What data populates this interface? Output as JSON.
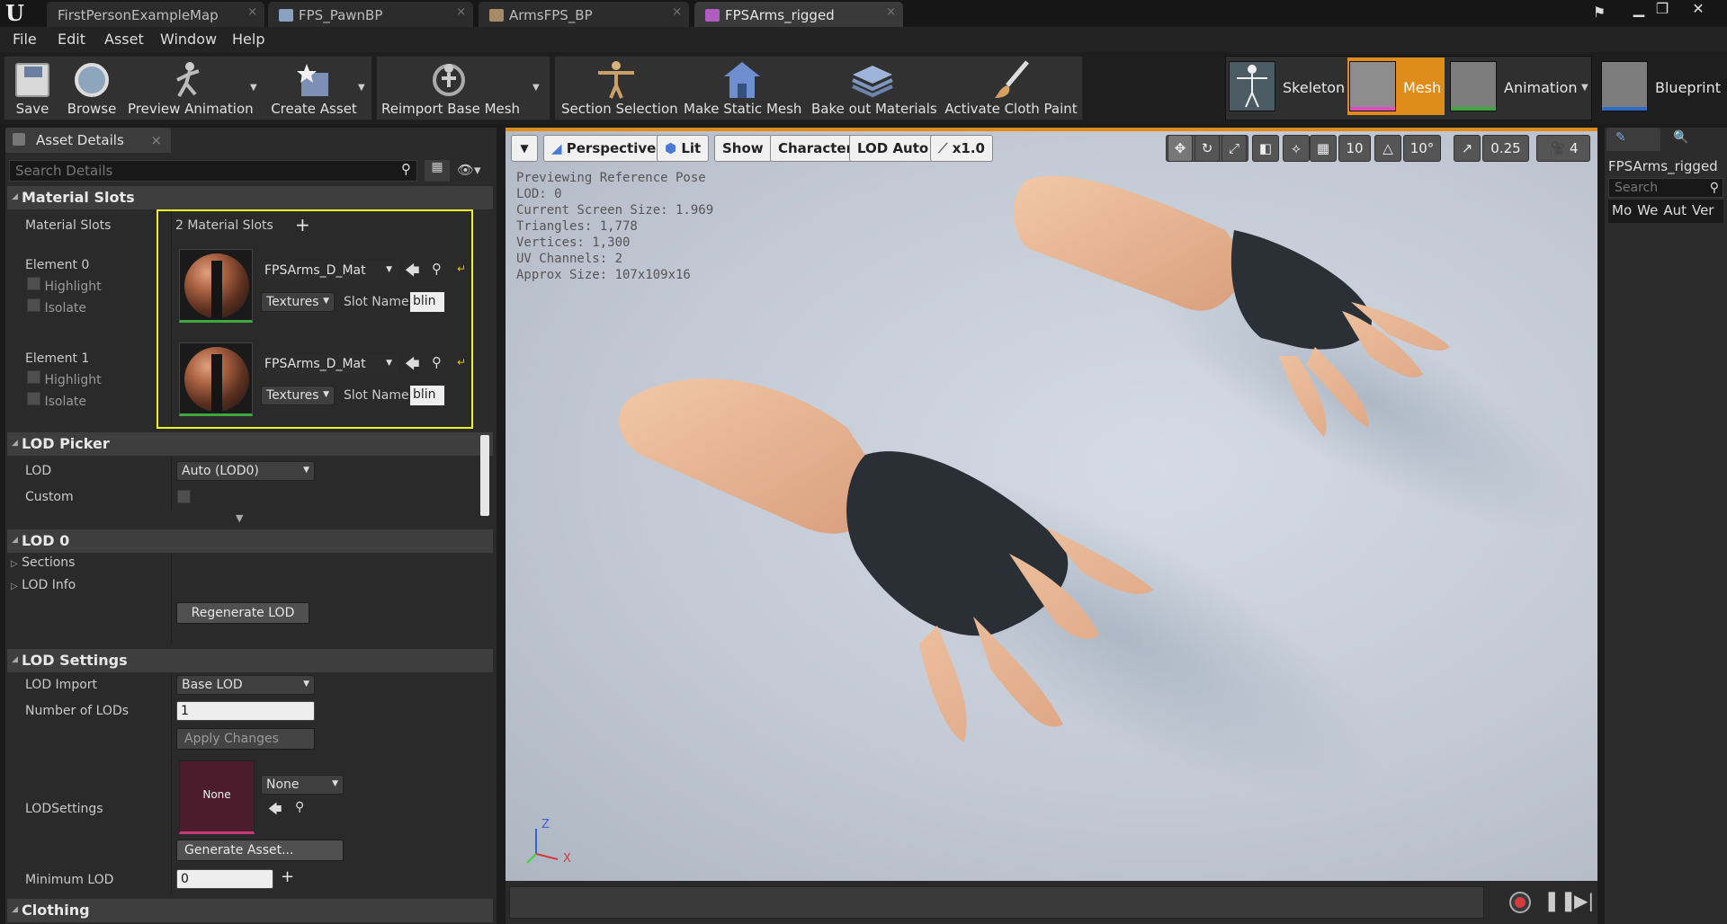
{
  "tabs": [
    {
      "label": "FirstPersonExampleMap"
    },
    {
      "label": "FPS_PawnBP"
    },
    {
      "label": "ArmsFPS_BP"
    },
    {
      "label": "FPSArms_rigged"
    }
  ],
  "menu": [
    "File",
    "Edit",
    "Asset",
    "Window",
    "Help"
  ],
  "toolbar": {
    "save": "Save",
    "browse": "Browse",
    "preview_animation": "Preview Animation",
    "create_asset": "Create Asset",
    "reimport": "Reimport Base Mesh",
    "section_selection": "Section Selection",
    "make_static": "Make Static Mesh",
    "bake": "Bake out Materials",
    "cloth": "Activate Cloth Paint"
  },
  "modes": {
    "skeleton": "Skeleton",
    "mesh": "Mesh",
    "animation": "Animation",
    "blueprint": "Blueprint",
    "active_color": "#e08c1a"
  },
  "details": {
    "tab": "Asset Details",
    "search_placeholder": "Search Details",
    "material_slots": {
      "header": "Material Slots",
      "label": "Material Slots",
      "count": "2 Material Slots",
      "elements": [
        {
          "name": "Element 0",
          "highlight": "Highlight",
          "isolate": "Isolate",
          "material": "FPSArms_D_Mat",
          "textures": "Textures",
          "slot_name_label": "Slot Name",
          "slot_name": "blin"
        },
        {
          "name": "Element 1",
          "highlight": "Highlight",
          "isolate": "Isolate",
          "material": "FPSArms_D_Mat",
          "textures": "Textures",
          "slot_name_label": "Slot Name",
          "slot_name": "blin"
        }
      ]
    },
    "lod_picker": {
      "header": "LOD Picker",
      "lod_label": "LOD",
      "lod_value": "Auto (LOD0)",
      "custom_label": "Custom"
    },
    "lod0": {
      "header": "LOD 0",
      "sections": "Sections",
      "lod_info": "LOD Info",
      "regenerate": "Regenerate LOD"
    },
    "lod_settings": {
      "header": "LOD Settings",
      "lod_import_label": "LOD Import",
      "lod_import_value": "Base LOD",
      "num_lods_label": "Number of LODs",
      "num_lods_value": "1",
      "apply": "Apply Changes",
      "lodsettings_label": "LODSettings",
      "none_thumb": "None",
      "none_combo": "None",
      "generate": "Generate Asset...",
      "min_lod_label": "Minimum LOD",
      "min_lod_value": "0"
    },
    "clothing": {
      "header": "Clothing"
    }
  },
  "viewport": {
    "perspective": "Perspective",
    "lit": "Lit",
    "show": "Show",
    "character": "Character",
    "lod_auto": "LOD Auto",
    "speed": "x1.0",
    "grid": "10",
    "rot": "10°",
    "scale": "0.25",
    "cam": "4",
    "stats": [
      "Previewing Reference Pose",
      "LOD: 0",
      "Current Screen Size: 1.969",
      "Triangles: 1,778",
      "Vertices: 1,300",
      "UV Channels: 2",
      "Approx Size: 107x109x16"
    ],
    "axes": {
      "z": "Z",
      "x": "X"
    }
  },
  "right_panel": {
    "title": "FPSArms_rigged",
    "search_placeholder": "Search",
    "columns": [
      "Mo",
      "We",
      "Aut",
      "Ver"
    ]
  }
}
